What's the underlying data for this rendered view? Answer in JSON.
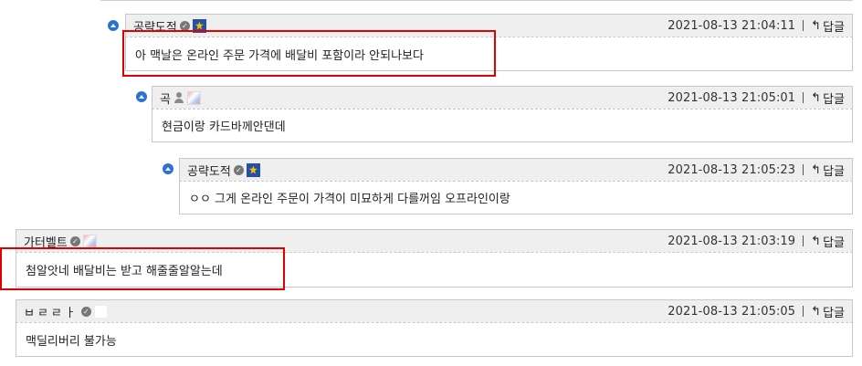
{
  "reply_label": "답글",
  "colors": {
    "accent_blue": "#2a72d6",
    "highlight_red": "#e00000"
  },
  "comments": [
    {
      "nick": "공략도적",
      "date": "2021-08-13 21:04:11",
      "text": "아 맥날은 온라인 주문 가격에 배달비 포함이라 안되나보다",
      "badge": "star-badge-icon"
    },
    {
      "nick": "곡",
      "date": "2021-08-13 21:05:01",
      "text": "현금이랑 카드바께안댄데",
      "badge": "image-badge-icon"
    },
    {
      "nick": "공략도적",
      "date": "2021-08-13 21:05:23",
      "text": "ㅇㅇ 그게 온라인 주문이 가격이 미묘하게 다를꺼임 오프라인이랑",
      "badge": "star-badge-icon"
    },
    {
      "nick": "가터벨트",
      "date": "2021-08-13 21:03:19",
      "text": "첨알앗네 배달비는 받고 해줄줄알알는데",
      "badge": "image-badge-icon"
    },
    {
      "nick": "ㅂㄹㄹㅏ",
      "date": "2021-08-13 21:05:05",
      "text": "맥딜리버리 불가능",
      "badge": "blank-badge"
    }
  ]
}
